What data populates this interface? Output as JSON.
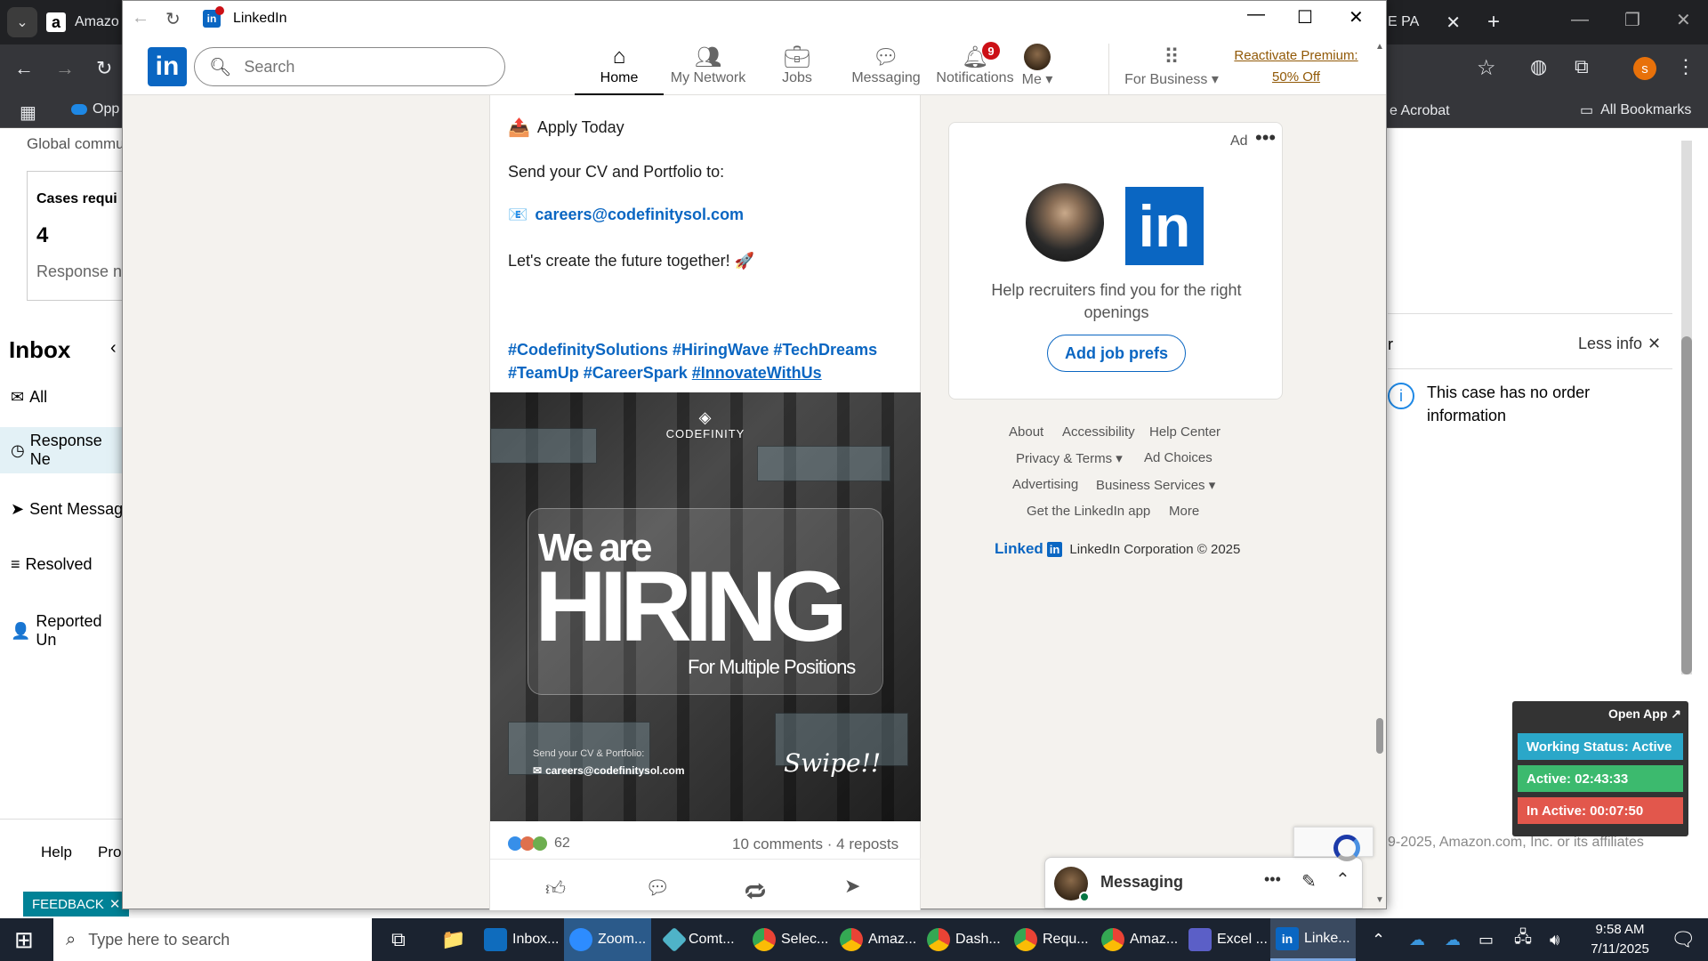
{
  "bg_chrome": {
    "tab_title": "Amazo",
    "right_tab_title": "E PA",
    "bookmark_left": "Opp",
    "bookmark_right_1": "e Acrobat",
    "bookmark_right_2": "All Bookmarks",
    "profile_initial": "s",
    "left_panel": {
      "global_text": "Global commu",
      "cases_label": "Cases requi",
      "cases_count": "4",
      "response_text": "Response n",
      "inbox_title": "Inbox",
      "nav": [
        "All",
        "Response Ne",
        "Sent Messag",
        "Resolved",
        "Reported Un"
      ],
      "help": "Help",
      "pro": "Pro",
      "feedback": "FEEDBACK"
    },
    "right_panel": {
      "letter": "r",
      "less_info": "Less info",
      "no_order": "This case has no order information",
      "copyright": "9-2025, Amazon.com, Inc. or its affiliates"
    }
  },
  "window": {
    "title": "LinkedIn"
  },
  "nav": {
    "search_placeholder": "Search",
    "items": [
      {
        "label": "Home"
      },
      {
        "label": "My Network"
      },
      {
        "label": "Jobs"
      },
      {
        "label": "Messaging"
      },
      {
        "label": "Notifications",
        "badge": "9"
      },
      {
        "label": "Me"
      },
      {
        "label": "For Business"
      }
    ],
    "premium_line1": "Reactivate Premium:",
    "premium_line2": "50% Off"
  },
  "post": {
    "apply": "Apply Today",
    "send_cv": "Send your CV and Portfolio to:",
    "email": "careers@codefinitysol.com",
    "future": "Let's create the future together! 🚀",
    "hashtags_line1": "#CodefinitySolutions #HiringWave #TechDreams",
    "hashtags_line2a": "#TeamUp #CareerSpark ",
    "hashtags_line2b": "#InnovateWithUs",
    "image": {
      "brand": "CODEFINITY",
      "we_are": "We are",
      "hiring": "HIRING",
      "positions": "For Multiple Positions",
      "send_cv": "Send your CV & Portfolio:",
      "email": "careers@codefinitysol.com",
      "swipe": "Swipe!!"
    },
    "reactions_count": "62",
    "comments_reposts": "10 comments · 4 reposts"
  },
  "ad": {
    "label": "Ad",
    "text": "Help recruiters find you for the right openings",
    "button": "Add job prefs"
  },
  "footer": {
    "links_row1": [
      "About",
      "Accessibility",
      "Help Center"
    ],
    "links_row2": [
      "Privacy & Terms",
      "Ad Choices"
    ],
    "links_row3": [
      "Advertising",
      "Business Services"
    ],
    "links_row4": [
      "Get the LinkedIn app",
      "More"
    ],
    "corp": "LinkedIn Corporation © 2025",
    "logo_text": "Linked"
  },
  "messaging": {
    "label": "Messaging"
  },
  "status": {
    "open_app": "Open App ↗",
    "working": "Working Status: Active",
    "active": "Active: 02:43:33",
    "inactive": "In Active: 00:07:50",
    "colors": {
      "working": "#2aa7c9",
      "active": "#3cba6e",
      "inactive": "#e2574c"
    }
  },
  "taskbar": {
    "search_placeholder": "Type here to search",
    "apps": [
      "Inbox...",
      "Zoom...",
      "Comt...",
      "Selec...",
      "Amaz...",
      "Dash...",
      "Requ...",
      "Amaz...",
      "Excel ...",
      "Linke..."
    ],
    "time": "9:58 AM",
    "date": "7/11/2025"
  }
}
